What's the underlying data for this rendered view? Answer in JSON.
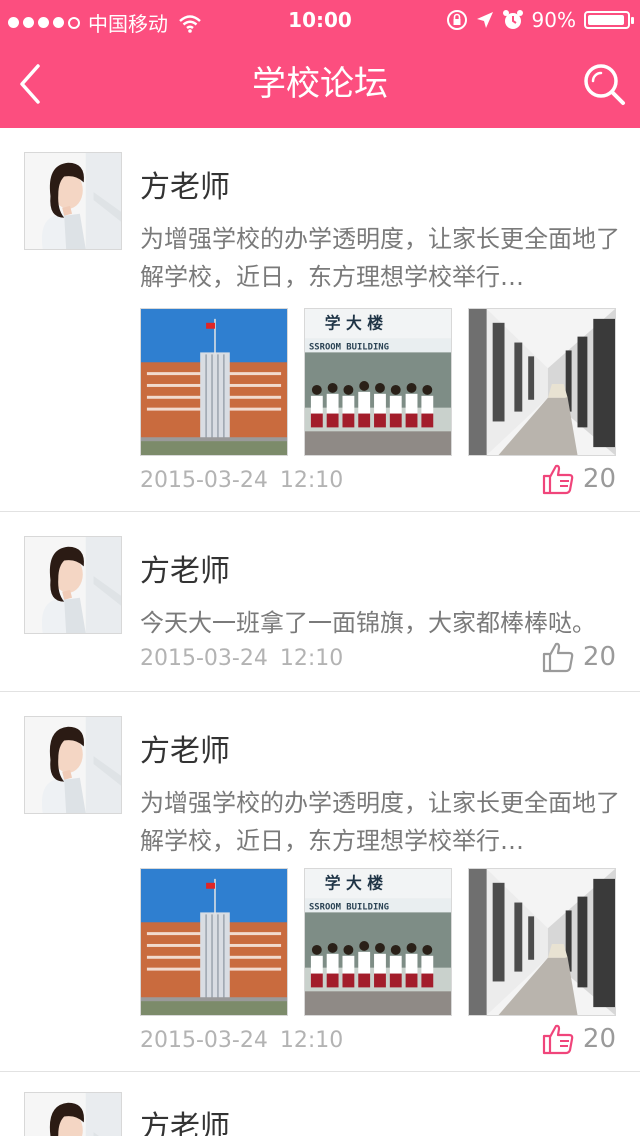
{
  "status_bar": {
    "carrier": "中国移动",
    "time": "10:00",
    "battery_percent": "90%"
  },
  "nav": {
    "title": "学校论坛",
    "back_icon": "chevron-left-icon",
    "search_icon": "search-icon"
  },
  "colors": {
    "brand": "#fc4e7f",
    "liked": "#f0457b",
    "not_liked": "#9a9a9a"
  },
  "posts": [
    {
      "author": "方老师",
      "content": "为增强学校的办学透明度，让家长更全面地了解学校，近日，东方理想学校举行…",
      "images": [
        "school-building",
        "students-group",
        "school-corridor"
      ],
      "date": "2015-03-24",
      "time": "12:10",
      "likes": "20",
      "liked": true
    },
    {
      "author": "方老师",
      "content": "今天大一班拿了一面锦旗，大家都棒棒哒。",
      "images": [],
      "date": "2015-03-24",
      "time": "12:10",
      "likes": "20",
      "liked": false
    },
    {
      "author": "方老师",
      "content": "为增强学校的办学透明度，让家长更全面地了解学校，近日，东方理想学校举行…",
      "images": [
        "school-building",
        "students-group",
        "school-corridor"
      ],
      "date": "2015-03-24",
      "time": "12:10",
      "likes": "20",
      "liked": true
    },
    {
      "author": "方老师",
      "content": "",
      "images": [],
      "date": "",
      "time": "",
      "likes": "",
      "liked": false
    }
  ]
}
